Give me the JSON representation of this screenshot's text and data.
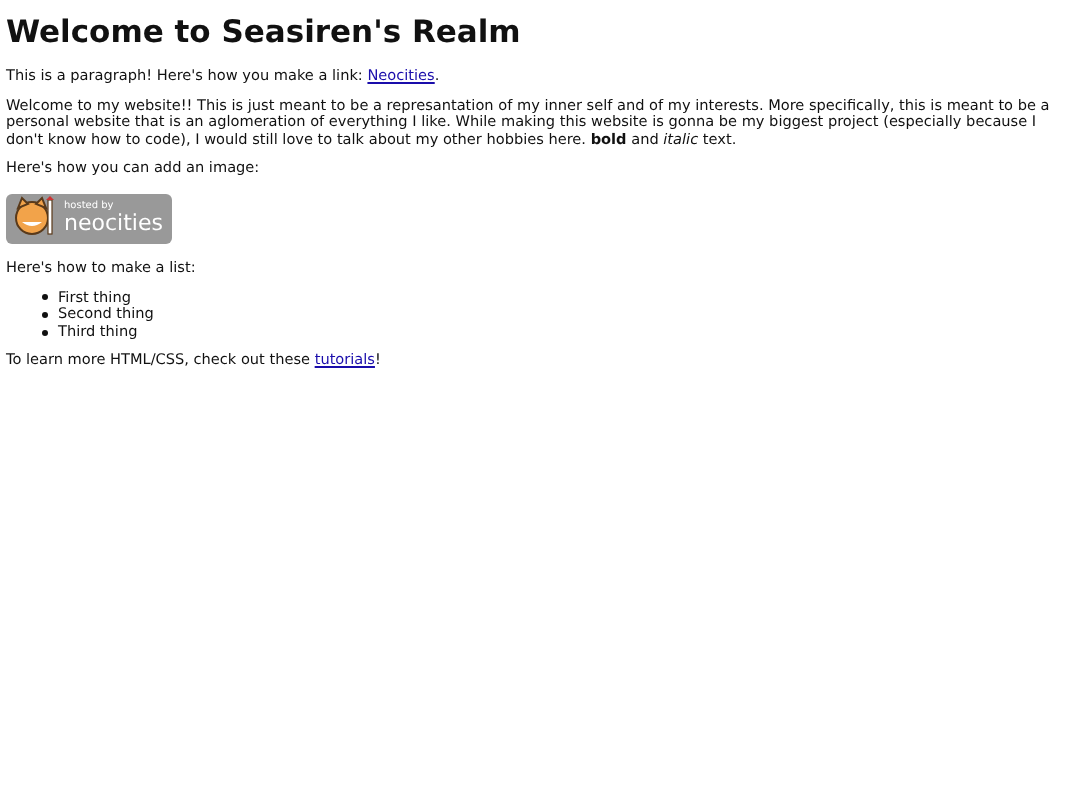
{
  "heading": "Welcome to Seasiren's Realm",
  "paragraphs": [
    {
      "kind": "link",
      "before": "This is a paragraph! Here's how you make a link: ",
      "link": "Neocities",
      "after": "."
    },
    {
      "kind": "text",
      "text": "Welcome to my website!! This is just meant to be a represantation of my inner self and of my interests. More specifically, this is meant to be a personal website that is an aglomeration of everything I like. While making this website is gonna be my biggest project (especially because I don't know how to code), I would still love to talk about my other hobbies here. **bold** and *italic* text."
    },
    {
      "kind": "text",
      "text": "Here's how you can add an image:"
    },
    {
      "kind": "badge",
      "small": "hosted by",
      "big": "neocities"
    },
    {
      "kind": "text",
      "text": "Here's how to make a list:"
    },
    {
      "kind": "list",
      "items": [
        "First thing",
        "Second thing",
        "Third thing"
      ]
    },
    {
      "kind": "link",
      "before": "To learn more HTML/CSS, check out these ",
      "link": "tutorials",
      "after": "!"
    }
  ]
}
